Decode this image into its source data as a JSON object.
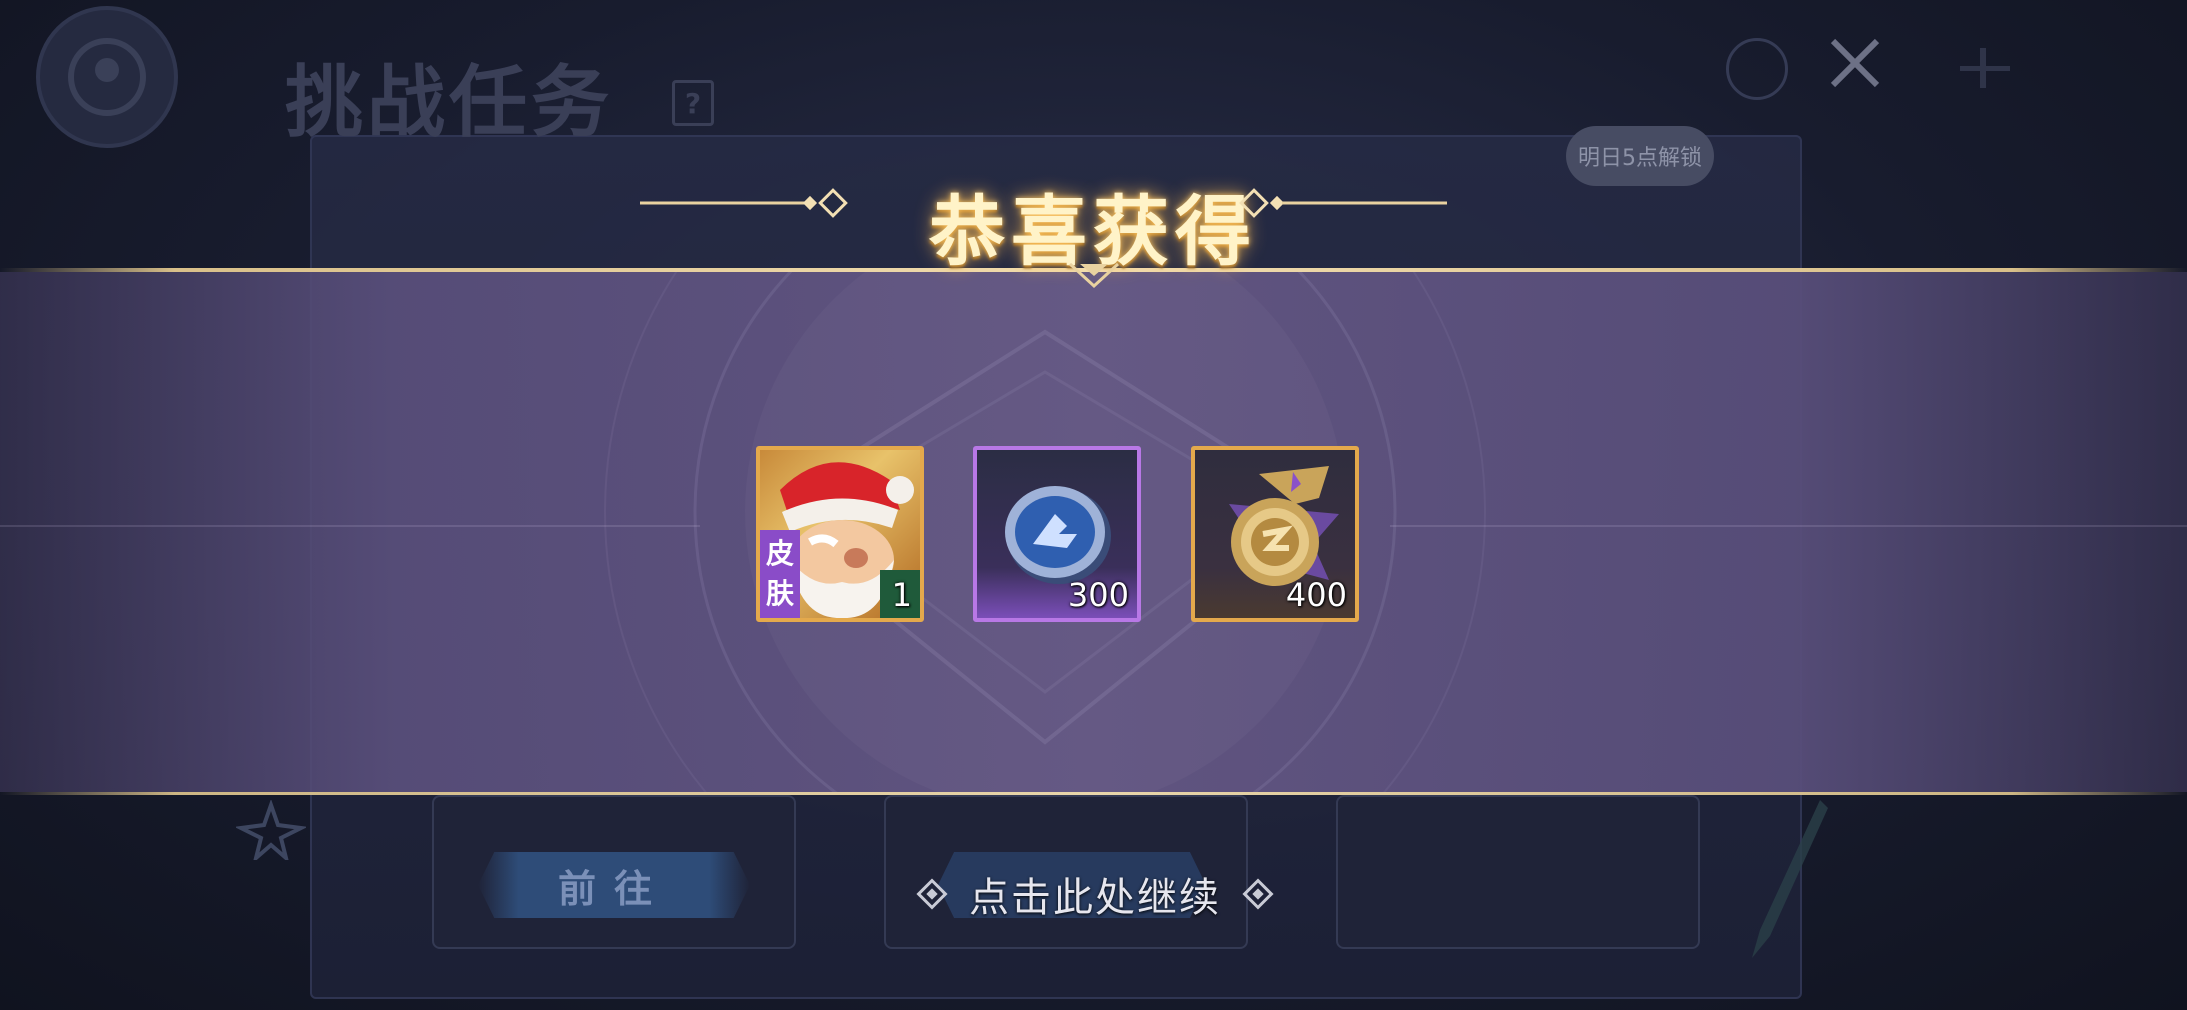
{
  "background": {
    "page_title": "挑战任务",
    "help_label": "?",
    "tooltip": "明日5点解锁",
    "goto_button_label": "前往"
  },
  "dialog": {
    "title": "恭喜获得",
    "rewards": [
      {
        "name": "Santa skin",
        "tag": "皮肤",
        "quantity": "1",
        "frame": "gold",
        "icon": "santa-skin-icon"
      },
      {
        "name": "coupon",
        "quantity": "300",
        "frame": "purple",
        "icon": "blue-coin-icon"
      },
      {
        "name": "medal",
        "quantity": "400",
        "frame": "gold",
        "icon": "gold-medal-icon"
      }
    ],
    "continue_label": "点击此处继续"
  },
  "colors": {
    "banner": "#5f5480",
    "gold_frame": "#e4a94c",
    "purple_frame": "#b878e6",
    "title_glow": "#ffbe50"
  }
}
